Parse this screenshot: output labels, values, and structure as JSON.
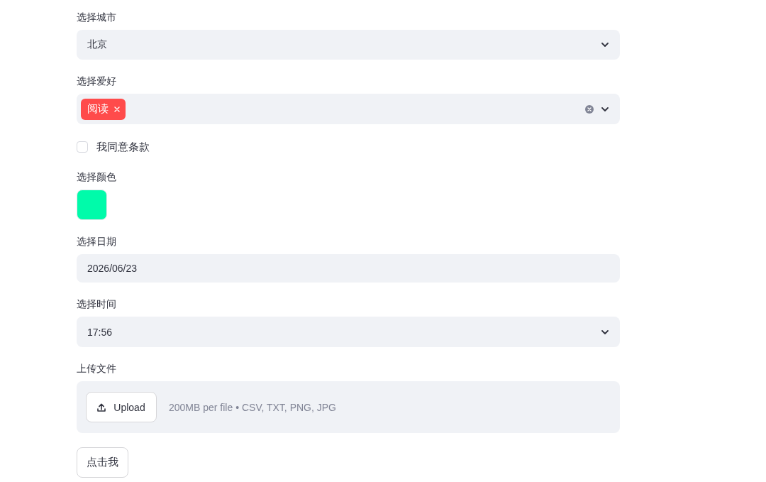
{
  "fields": [
    {
      "kind": "select",
      "label": "选择城市",
      "value": "北京"
    },
    {
      "kind": "multiselect",
      "label": "选择爱好",
      "tags": [
        "阅读"
      ]
    },
    {
      "kind": "checkbox",
      "label": "我同意条款",
      "checked": false
    },
    {
      "kind": "color",
      "label": "选择颜色",
      "color": "#00fbaa"
    },
    {
      "kind": "date",
      "label": "选择日期",
      "value": "2026/06/23"
    },
    {
      "kind": "time",
      "label": "选择时间",
      "value": "17:56"
    },
    {
      "kind": "file",
      "label": "上传文件",
      "button": "Upload",
      "hint": "200MB per file • CSV, TXT, PNG, JPG"
    },
    {
      "kind": "button",
      "text": "点击我"
    }
  ]
}
